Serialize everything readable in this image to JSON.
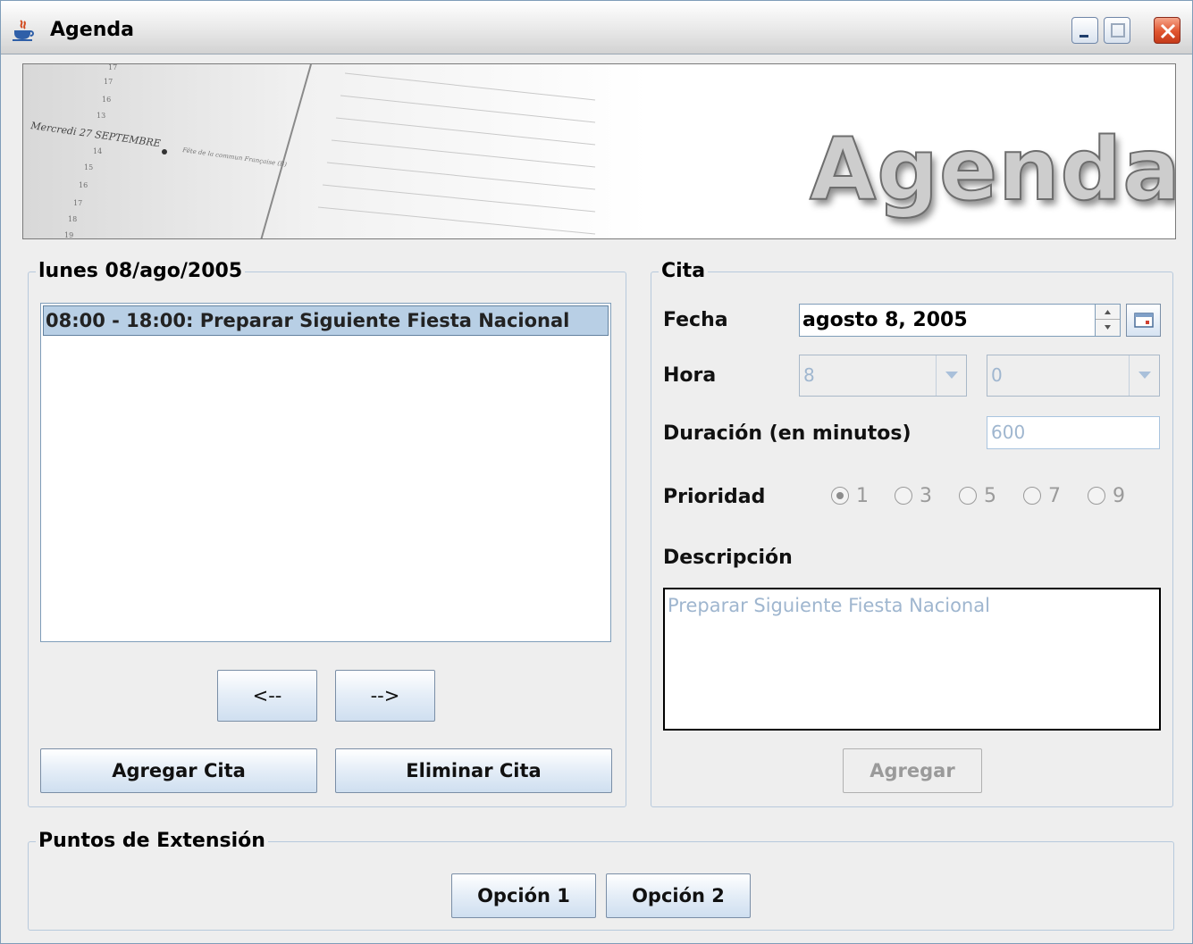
{
  "window": {
    "title": "Agenda"
  },
  "banner": {
    "title": "Agenda",
    "diary_text": {
      "day": "Mercredi 27 SEPTEMBRE",
      "note": "Fête de la commun Française (B)"
    }
  },
  "appointments": {
    "group_title": "lunes 08/ago/2005",
    "items": [
      "08:00 - 18:00: Preparar Siguiente Fiesta Nacional"
    ],
    "prev_label": "<--",
    "next_label": "-->",
    "add_label": "Agregar Cita",
    "delete_label": "Eliminar Cita"
  },
  "cita": {
    "group_title": "Cita",
    "fecha_label": "Fecha",
    "fecha_value": "agosto 8, 2005",
    "hora_label": "Hora",
    "hora_value": "8",
    "minuto_value": "0",
    "duracion_label": "Duración (en minutos)",
    "duracion_value": "600",
    "prioridad_label": "Prioridad",
    "prioridad_options": [
      "1",
      "3",
      "5",
      "7",
      "9"
    ],
    "prioridad_selected": "1",
    "descripcion_label": "Descripción",
    "descripcion_value": "Preparar Siguiente Fiesta Nacional",
    "agregar_label": "Agregar"
  },
  "extension": {
    "group_title": "Puntos de Extensión",
    "option1_label": "Opción 1",
    "option2_label": "Opción 2"
  },
  "colors": {
    "selection": "#b8cfe5",
    "border": "#7f9db9",
    "disabled_text": "#9fb6cf",
    "background": "#eeeeee"
  }
}
